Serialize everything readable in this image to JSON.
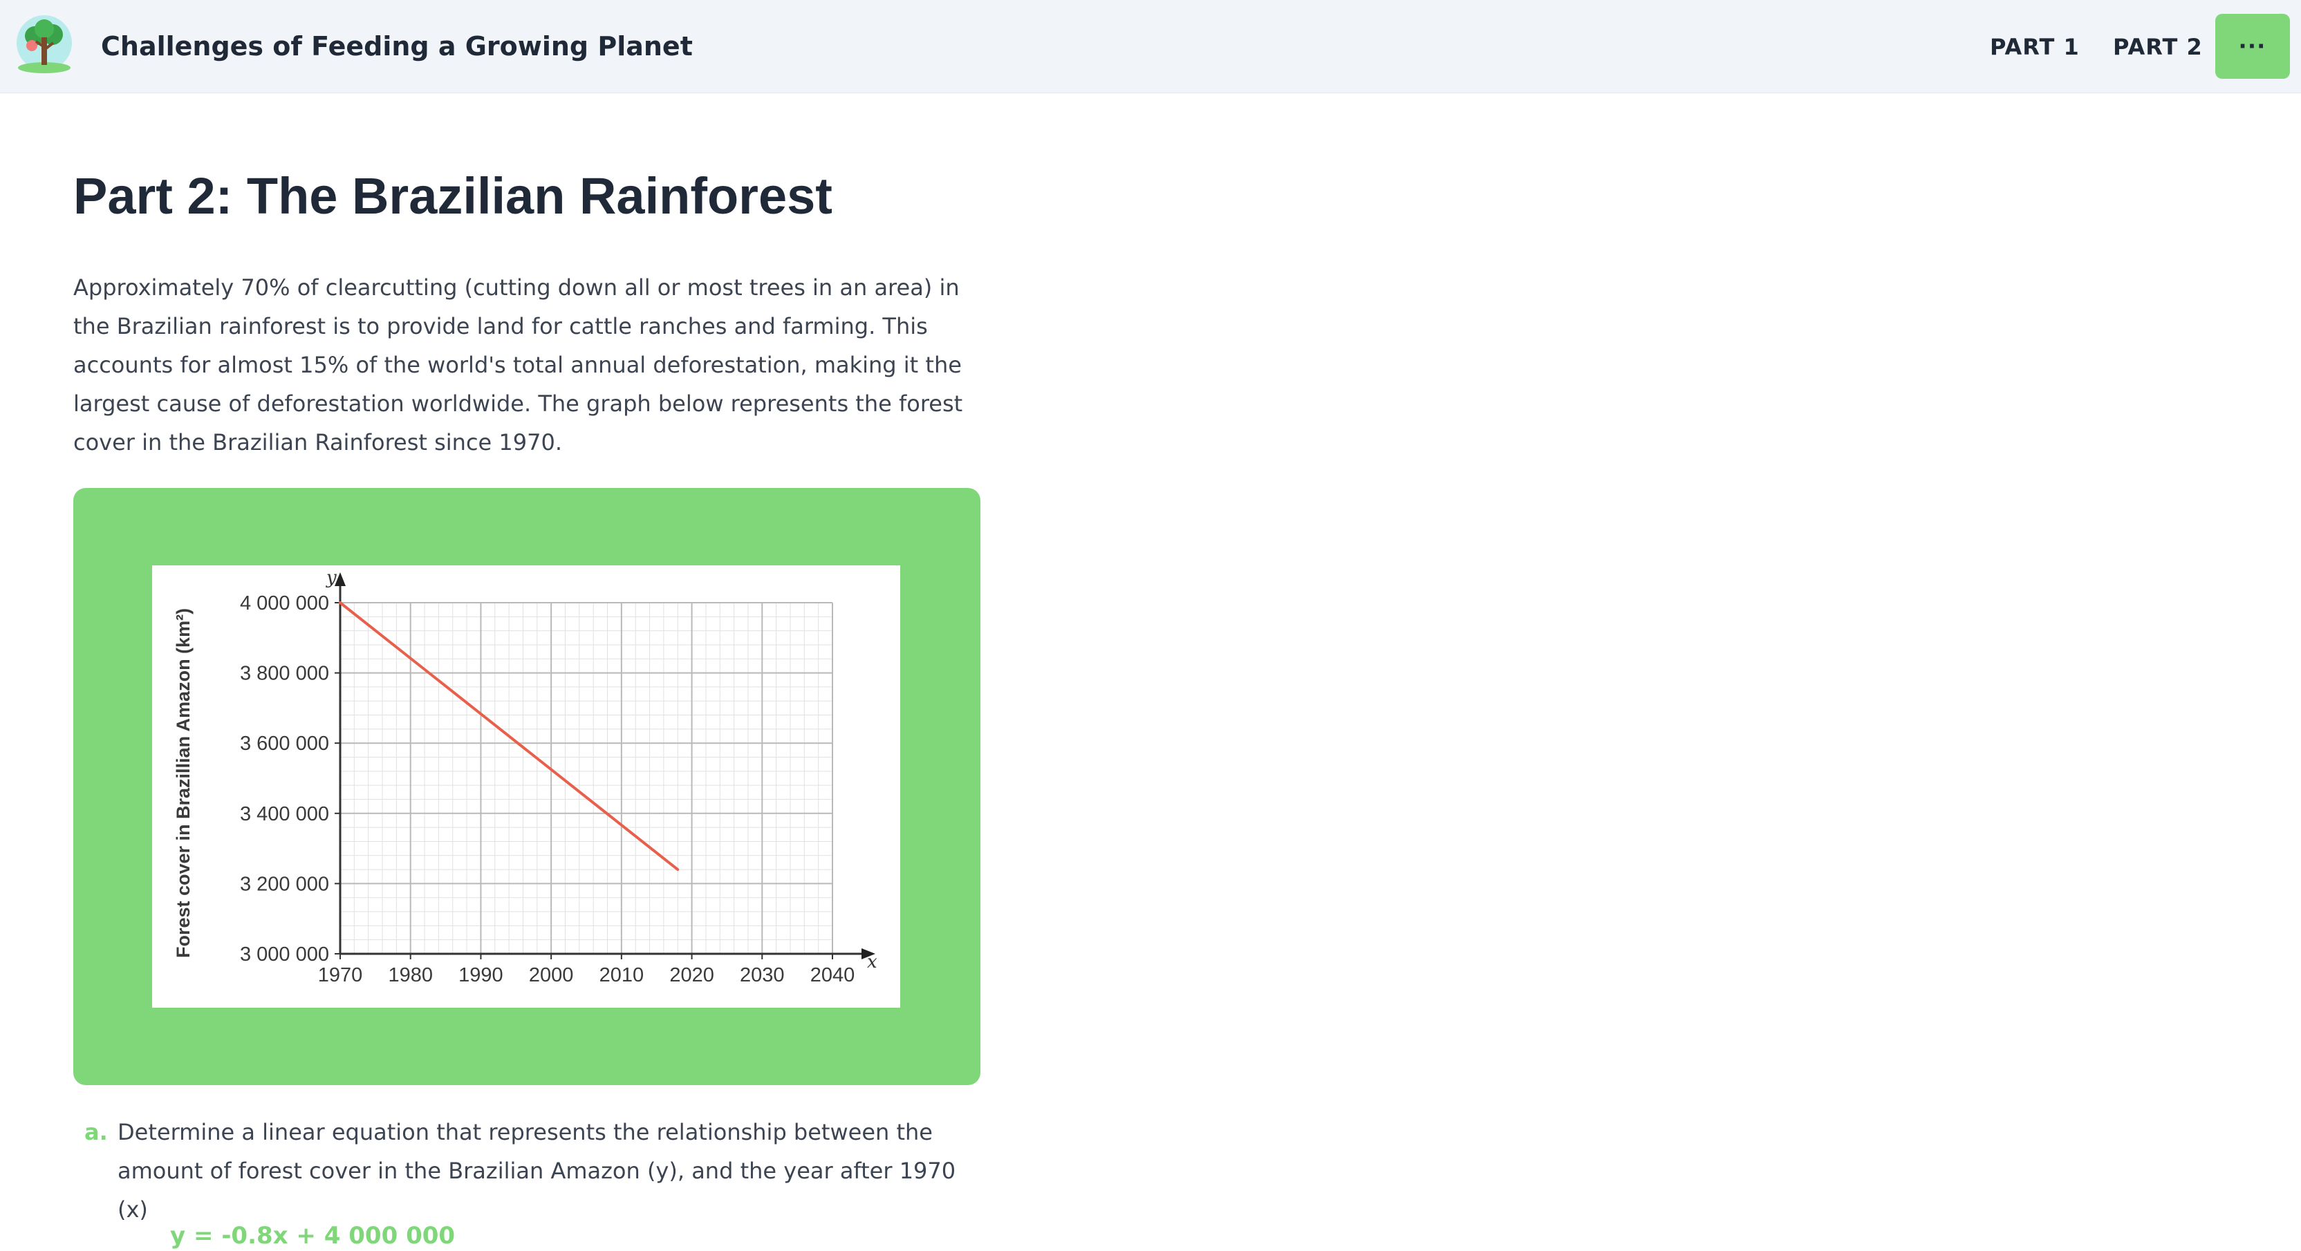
{
  "header": {
    "logo": "tree-logo",
    "title": "Challenges of Feeding a Growing Planet",
    "nav": [
      {
        "label": "PART 1"
      },
      {
        "label": "PART 2"
      }
    ],
    "more_label": "···"
  },
  "content": {
    "title": "Part 2: The Brazilian Rainforest",
    "intro": "Approximately 70% of clearcutting (cutting down all or most trees in an area) in the Brazilian rainforest is to provide land for cattle ranches and farming. This accounts for almost 15% of the world's total annual deforestation, making it the largest cause of deforestation worldwide. The graph below represents the forest cover in the Brazilian Rainforest since 1970.",
    "question": {
      "letter": "a.",
      "text": "Determine a linear equation that represents the relationship between the amount of forest cover in the Brazilian Amazon (y), and the year after 1970 (x)",
      "answer": "y = -0.8x + 4 000 000"
    }
  },
  "colors": {
    "accent": "#7fd77a",
    "line": "#e8604c",
    "text": "#1f2937",
    "header_bg": "#f1f4f8"
  },
  "chart_data": {
    "type": "line",
    "ylabel": "Forest cover in Brazillian Amazon (km²)",
    "xlabel": "",
    "x_axis_letter": "x",
    "y_axis_letter": "y",
    "x_ticks": [
      "1970",
      "1980",
      "1990",
      "2000",
      "2010",
      "2020",
      "2030",
      "2040"
    ],
    "y_ticks": [
      "3 000 000",
      "3 200 000",
      "3 400 000",
      "3 600 000",
      "3 800 000",
      "4 000 000"
    ],
    "xlim": [
      1970,
      2040
    ],
    "ylim": [
      3000000,
      4000000
    ],
    "grid": true,
    "series": [
      {
        "x": [
          1970,
          2018
        ],
        "y": [
          4000000,
          3240000
        ]
      }
    ]
  }
}
